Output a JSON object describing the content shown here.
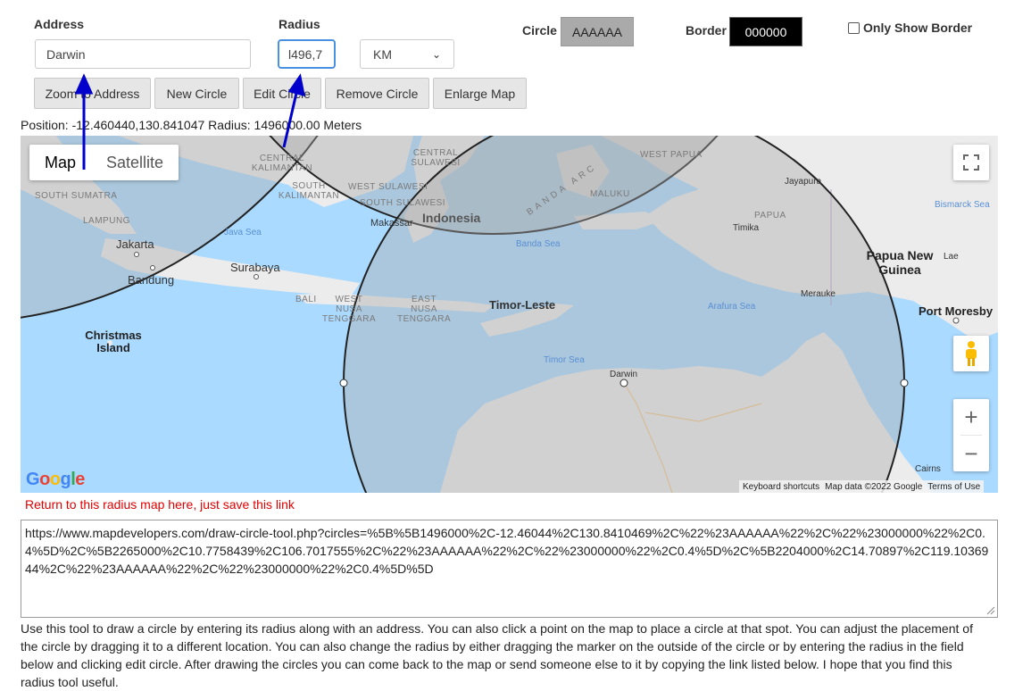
{
  "form": {
    "address_label": "Address",
    "address_value": "Darwin",
    "radius_label": "Radius",
    "radius_value": "l496,7",
    "unit_value": "KM",
    "circle_label": "Circle",
    "circle_value": "AAAAAA",
    "border_label": "Border",
    "border_value": "000000",
    "only_border_label": "Only Show Border"
  },
  "buttons": {
    "zoom_address": "Zoom to Address",
    "new_circle": "New Circle",
    "edit_circle": "Edit Circle",
    "remove_circle": "Remove Circle",
    "enlarge_map": "Enlarge Map"
  },
  "position_text": "Position: -12.460440,130.841047 Radius: 1496000.00 Meters",
  "map": {
    "type_map": "Map",
    "type_satellite": "Satellite",
    "google_logo": "Google",
    "labels": {
      "sumatra": "SOUTH SUMATRA",
      "lampung": "LAMPUNG",
      "jakarta": "Jakarta",
      "bandung": "Bandung",
      "surabaya": "Surabaya",
      "java_sea": "Java Sea",
      "kalimantan": "CENTRAL KALIMANTAN",
      "south_kalimantan": "SOUTH KALIMANTAN",
      "central_sulawesi": "CENTRAL SULAWESI",
      "west_sulawesi": "WEST SULAWESI",
      "south_sulawesi": "SOUTH SULAWESI",
      "makassar": "Makassar",
      "indonesia": "Indonesia",
      "banda_arc": "BANDA ARC",
      "banda_sea": "Banda Sea",
      "maluku": "MALUKU",
      "west_papua": "WEST PAPUA",
      "papua": "PAPUA",
      "timika": "Timika",
      "jayapura": "Jayapura",
      "bismarck": "Bismarck Sea",
      "png": "Papua New Guinea",
      "lae": "Lae",
      "port_moresby": "Port Moresby",
      "merauke": "Merauke",
      "arafura": "Arafura Sea",
      "bali": "BALI",
      "west_nusa": "WEST NUSA TENGGARA",
      "east_nusa": "EAST NUSA TENGGARA",
      "timor_leste": "Timor-Leste",
      "timor_sea": "Timor Sea",
      "darwin": "Darwin",
      "christmas": "Christmas Island",
      "cairns": "Cairns"
    },
    "attribution": {
      "shortcuts": "Keyboard shortcuts",
      "data": "Map data ©2022 Google",
      "terms": "Terms of Use"
    }
  },
  "return_link_text": "Return to this radius map here, just save this link",
  "link_url": "https://www.mapdevelopers.com/draw-circle-tool.php?circles=%5B%5B1496000%2C-12.46044%2C130.8410469%2C%22%23AAAAAA%22%2C%22%23000000%22%2C0.4%5D%2C%5B2265000%2C10.7758439%2C106.7017555%2C%22%23AAAAAA%22%2C%22%23000000%22%2C0.4%5D%2C%5B2204000%2C14.70897%2C119.1036944%2C%22%23AAAAAA%22%2C%22%23000000%22%2C0.4%5D%5D",
  "description": "Use this tool to draw a circle by entering its radius along with an address. You can also click a point on the map to place a circle at that spot. You can adjust the placement of the circle by dragging it to a different location. You can also change the radius by either dragging the marker on the outside of the circle or by entering the radius in the field below and clicking edit circle. After drawing the circles you can come back to the map or send someone else to it by copying the link listed below. I hope that you find this radius tool useful.",
  "colors": {
    "accent_blue": "#0000cc",
    "circle_fill": "#AAAAAA",
    "circle_border": "#000000",
    "return_link": "#e00000"
  }
}
